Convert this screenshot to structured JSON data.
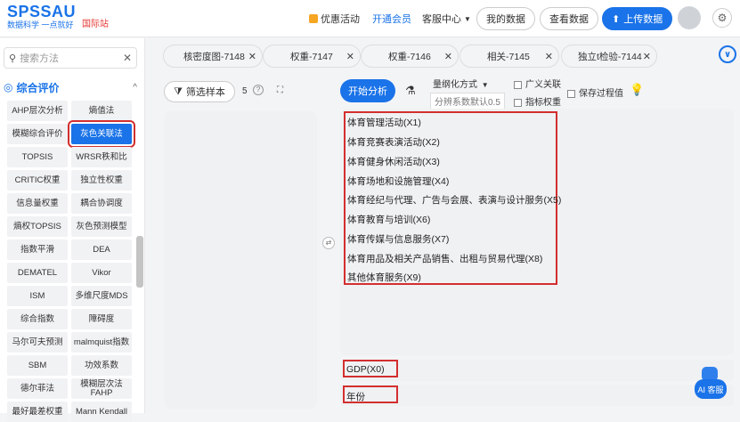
{
  "header": {
    "logo_main": "SPSSAU",
    "logo_sub": "数据科学 一点就好",
    "logo_intl": "国际站",
    "promo": "优惠活动",
    "vip": "开通会员",
    "service": "客服中心",
    "my_data": "我的数据",
    "view_data": "查看数据",
    "upload": "上传数据"
  },
  "sidebar": {
    "search_placeholder": "搜索方法",
    "category": "综合评价",
    "methods": [
      "AHP层次分析",
      "熵值法",
      "模糊综合评价",
      "灰色关联法",
      "TOPSIS",
      "WRSR秩和比",
      "CRITIC权重",
      "独立性权重",
      "信息量权重",
      "耦合协调度",
      "熵权TOPSIS",
      "灰色预测模型",
      "指数平滑",
      "DEA",
      "DEMATEL",
      "Vikor",
      "ISM",
      "多维尺度MDS",
      "综合指数",
      "障碍度",
      "马尔可夫预测",
      "malmquist指数",
      "SBM",
      "功效系数",
      "德尔菲法",
      "模糊层次法FAHP",
      "最好最差权重",
      "Mann Kendall"
    ]
  },
  "tabs": [
    "核密度图-7148",
    "权重-7147",
    "权重-7146",
    "相关-7145",
    "独立t检验-7144"
  ],
  "toolbar": {
    "filter": "筛选样本",
    "count": "5",
    "start": "开始分析",
    "quantize": "量纲化方式",
    "resolution": "分辨系数默认0.5",
    "generalized": "广义关联",
    "indicator_weight": "指标权重",
    "save_process": "保存过程值"
  },
  "variables": [
    "体育管理活动(X1)",
    "体育竞赛表演活动(X2)",
    "体育健身休闲活动(X3)",
    "体育场地和设施管理(X4)",
    "体育经纪与代理、广告与会展、表演与设计服务(X5)",
    "体育教育与培训(X6)",
    "体育传媒与信息服务(X7)",
    "体育用品及相关产品销售、出租与贸易代理(X8)",
    "其他体育服务(X9)"
  ],
  "ref_variable": "GDP(X0)",
  "time_variable": "年份",
  "ai_label": "AI 客服"
}
